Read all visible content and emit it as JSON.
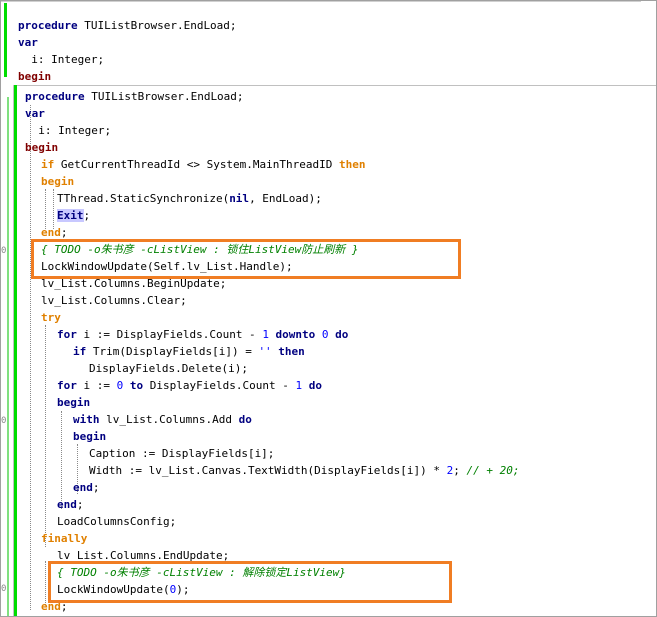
{
  "colors": {
    "keyword": "#000080",
    "end_keyword": "#800000",
    "control_keyword": "#e08000",
    "number": "#0000ff",
    "comment": "#008000",
    "callout_border": "#f07d23",
    "gutter_bar": "#00dd00"
  },
  "gutter_marks": [
    "0",
    "0",
    "0"
  ],
  "back_editor": {
    "line1": {
      "kw": "procedure",
      "rest": " TUIListBrowser.EndLoad;"
    },
    "line2": {
      "kw": "var"
    },
    "line3": {
      "text": "  i: Integer;"
    },
    "line4": {
      "kw": "begin"
    }
  },
  "code": {
    "l1": {
      "kw": "procedure",
      "rest": " TUIListBrowser.EndLoad;"
    },
    "l2": {
      "kw": "var"
    },
    "l3": {
      "text": "  i: Integer;"
    },
    "l4": {
      "kw": "begin"
    },
    "l5": {
      "kw": "if",
      "mid": " GetCurrentThreadId <> System.MainThreadID ",
      "kw2": "then"
    },
    "l6": {
      "kw": "begin"
    },
    "l7": {
      "pre": "TThread.StaticSynchronize(",
      "kw": "nil",
      "post": ", EndLoad);"
    },
    "l8": {
      "kw": "Exit",
      "post": ";"
    },
    "l9": {
      "kw": "end",
      "post": ";"
    },
    "l10": {
      "comment": "{ TODO -o朱书彦 -cListView : 锁住ListView防止刷新 }"
    },
    "l11": {
      "text": "LockWindowUpdate(Self.lv_List.Handle);"
    },
    "l12": {
      "text": "lv_List.Columns.BeginUpdate;"
    },
    "l13": {
      "text": "lv_List.Columns.Clear;"
    },
    "l14": {
      "kw": "try"
    },
    "l15": {
      "kw": "for",
      "a": " i := DisplayFields.Count - ",
      "n1": "1",
      "kw2": " downto ",
      "n2": "0",
      "kw3": " do"
    },
    "l16": {
      "kw": "if",
      "a": " Trim(DisplayFields[i]) = ",
      "s": "''",
      "kw2": " then"
    },
    "l17": {
      "text": "DisplayFields.Delete(i);"
    },
    "l18": {
      "kw": "for",
      "a": " i := ",
      "n1": "0",
      "kw2": " to",
      "b": " DisplayFields.Count - ",
      "n2": "1",
      "kw3": " do"
    },
    "l19": {
      "kw": "begin"
    },
    "l20": {
      "kw": "with",
      "a": " lv_List.Columns.Add ",
      "kw2": "do"
    },
    "l21": {
      "kw": "begin"
    },
    "l22": {
      "text": "Caption := DisplayFields[i];"
    },
    "l23": {
      "a": "Width := lv_List.Canvas.TextWidth(DisplayFields[i]) * ",
      "n1": "2",
      "b": "; ",
      "com": "// + 20;"
    },
    "l24": {
      "kw": "end",
      "post": ";"
    },
    "l25": {
      "kw": "end",
      "post": ";"
    },
    "l26": {
      "text": "LoadColumnsConfig;"
    },
    "l27": {
      "kw": "finally"
    },
    "l28": {
      "text": "lv_List.Columns.EndUpdate;"
    },
    "l29": {
      "comment": "{ TODO -o朱书彦 -cListView : 解除锁定ListView}"
    },
    "l30": {
      "a": "LockWindowUpdate(",
      "n1": "0",
      "b": ");"
    },
    "l31": {
      "kw": "end",
      "post": ";"
    }
  }
}
